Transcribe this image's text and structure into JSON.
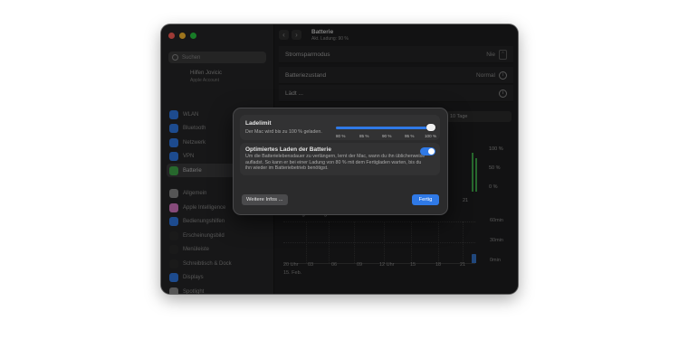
{
  "window": {
    "title": "Batterie",
    "subtitle": "Akt. Ladung: 90 %"
  },
  "sidebar": {
    "search_placeholder": "Suchen",
    "account_name": "Hilfen Jovicic",
    "account_sub": "Apple Account",
    "items": [
      {
        "label": "WLAN",
        "icon": "wifi-icon",
        "color": "#2f79e6"
      },
      {
        "label": "Bluetooth",
        "icon": "bluetooth-icon",
        "color": "#2f79e6"
      },
      {
        "label": "Netzwerk",
        "icon": "globe-icon",
        "color": "#2f79e6"
      },
      {
        "label": "VPN",
        "icon": "vpn-icon",
        "color": "#2f79e6"
      },
      {
        "label": "Batterie",
        "icon": "battery-icon",
        "color": "#3fa94a",
        "active": true
      },
      {
        "label": "Allgemein",
        "icon": "gear-icon",
        "color": "#8a8a8a"
      },
      {
        "label": "Apple Intelligence",
        "icon": "sparkle-icon",
        "color": "#d97ac6"
      },
      {
        "label": "Bedienungshilfen",
        "icon": "accessibility-icon",
        "color": "#2f79e6"
      },
      {
        "label": "Erscheinungsbild",
        "icon": "appearance-icon",
        "color": "#2a2a2a"
      },
      {
        "label": "Menüleiste",
        "icon": "menubar-icon",
        "color": "#2a2a2a"
      },
      {
        "label": "Schreibtisch & Dock",
        "icon": "dock-icon",
        "color": "#2a2a2a"
      },
      {
        "label": "Displays",
        "icon": "display-icon",
        "color": "#2f79e6"
      },
      {
        "label": "Spotlight",
        "icon": "spotlight-icon",
        "color": "#8a8a8a"
      }
    ]
  },
  "main": {
    "rows": [
      {
        "label": "Stromsparmodus",
        "value": "Nie"
      },
      {
        "label": "Batteriezustand",
        "value": "Normal"
      },
      {
        "label": "Lädt ..."
      }
    ],
    "range_tag": "10 Tage",
    "chart1_pcts": [
      "100 %",
      "50 %",
      "0 %"
    ],
    "chart1_xlabel": "21",
    "usage_title": "Nutzung bei eingeschaltetem Bildschirm",
    "chart2_ylabels": [
      "60min",
      "30min",
      "0min"
    ],
    "xlabels": [
      "20 Uhr",
      "03",
      "06",
      "09",
      "12 Uhr",
      "15",
      "18",
      "21"
    ],
    "date_label": "15. Feb."
  },
  "dialog": {
    "limit_title": "Ladelimit",
    "limit_desc": "Der Mac wird bis zu 100 % geladen.",
    "slider_value_percent": 100,
    "slider_ticks": [
      "80 %",
      "85 %",
      "90 %",
      "95 %",
      "100 %"
    ],
    "opt_title": "Optimiertes Laden der Batterie",
    "opt_desc": "Um die Batterielebensdauer zu verlängern, lernt der Mac, wann du ihn üblicherweise aufladst. So kann er bei einer Ladung von 80 % mit dem Fertigladen warten, bis du ihn wieder im Batteriebetrieb benötigst.",
    "opt_enabled": true,
    "more_button": "Weitere Infos ...",
    "done_button": "Fertig"
  }
}
